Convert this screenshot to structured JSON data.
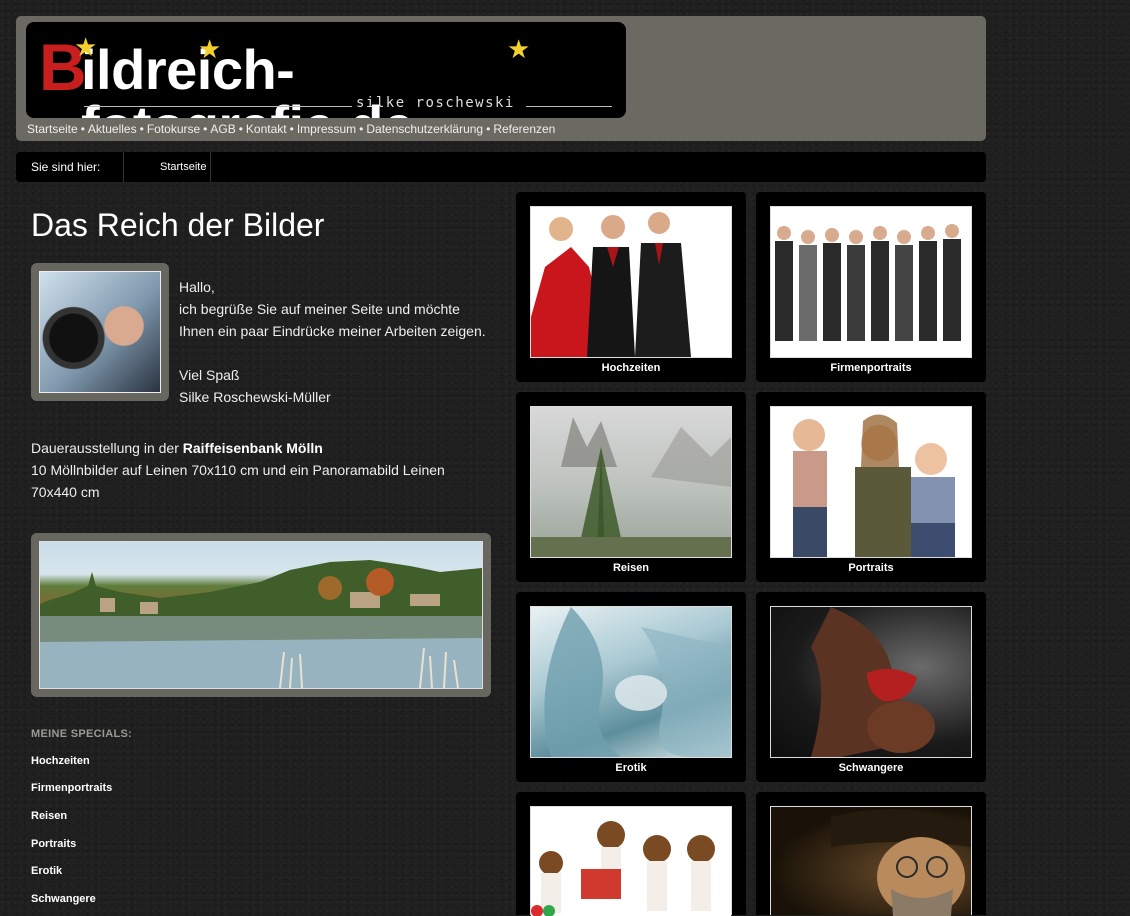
{
  "header": {
    "logo_initial": "B",
    "logo_rest": "ildreich-fotografie.de",
    "logo_sub": "silke    roschewski",
    "nav": [
      "Startseite",
      "Aktuelles",
      "Fotokurse",
      "AGB",
      "Kontakt",
      "Impressum",
      "Datenschutzerklärung",
      "Referenzen"
    ],
    "nav_separator": "•"
  },
  "breadcrumb": {
    "label": "Sie sind hier:",
    "current": "Startseite"
  },
  "main": {
    "title": "Das Reich der Bilder",
    "intro_lines": [
      "Hallo,",
      "ich begrüße Sie auf meiner Seite und möchte",
      "Ihnen ein paar Eindrücke meiner Arbeiten zeigen.",
      "",
      "Viel Spaß",
      "Silke Roschewski-Müller"
    ],
    "exhibit_prefix": "Dauerausstellung in der ",
    "exhibit_bold": "Raiffeisenbank Mölln",
    "exhibit_text": "10 Möllnbilder auf Leinen 70x110 cm und ein Panoramabild Leinen 70x440 cm"
  },
  "specials": {
    "heading": "MEINE SPECIALS:",
    "items": [
      "Hochzeiten",
      "Firmenportraits",
      "Reisen",
      "Portraits",
      "Erotik",
      "Schwangere"
    ]
  },
  "gallery": {
    "tiles": [
      {
        "caption": "Hochzeiten",
        "image": "wedding-photo"
      },
      {
        "caption": "Firmenportraits",
        "image": "corporate-group-photo"
      },
      {
        "caption": "Reisen",
        "image": "mountain-fog-photo"
      },
      {
        "caption": "Portraits",
        "image": "family-portrait-photo"
      },
      {
        "caption": "Erotik",
        "image": "erotic-photo"
      },
      {
        "caption": "Schwangere",
        "image": "pregnancy-photo"
      },
      {
        "caption": "",
        "image": "beagle-puppies-photo"
      },
      {
        "caption": "",
        "image": "costume-portrait-photo"
      }
    ]
  },
  "colors": {
    "header_bg": "#6b6a62",
    "logo_accent": "#c81e1e",
    "star": "#f2d02d",
    "tile_bg": "#000000"
  }
}
